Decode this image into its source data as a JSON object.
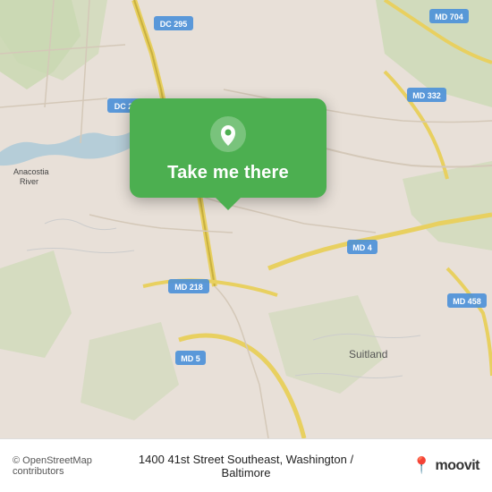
{
  "map": {
    "background_color": "#e8e0d8",
    "attribution": "© OpenStreetMap contributors"
  },
  "popup": {
    "label": "Take me there",
    "icon": "location-pin"
  },
  "bottom_bar": {
    "copyright": "© OpenStreetMap contributors",
    "address": "1400 41st Street Southeast, Washington / Baltimore",
    "logo_text": "moovit",
    "logo_pin": "📍"
  }
}
